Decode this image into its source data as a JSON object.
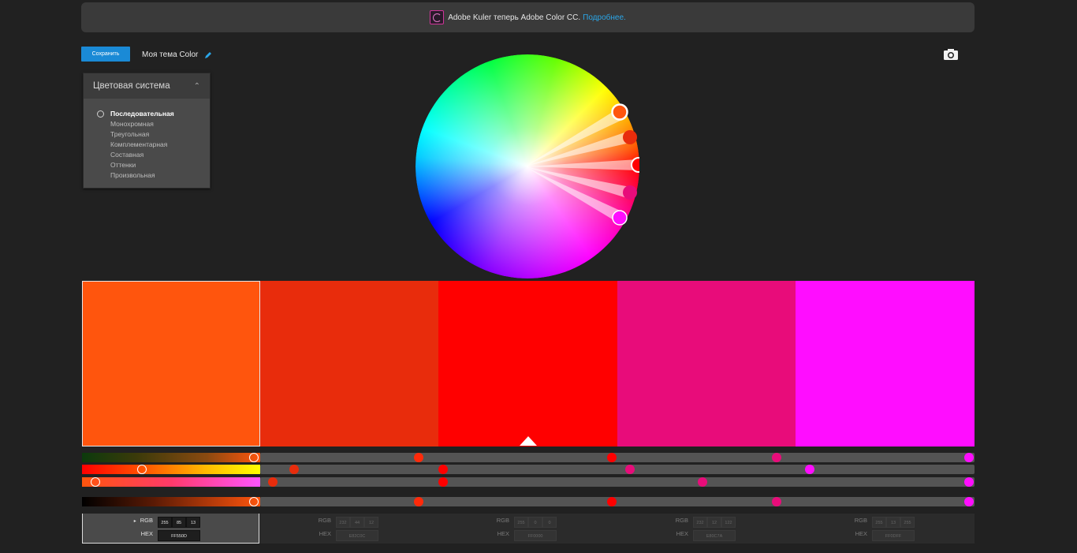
{
  "banner": {
    "text": "Adobe Kuler теперь Adobe Color CC.",
    "link": "Подробнее.",
    "icon": "adobe-color-logo-icon"
  },
  "toolbar": {
    "save_label": "Сохранить",
    "theme_name": "Моя тема Color",
    "edit_icon": "pencil-icon",
    "camera_icon": "camera-icon"
  },
  "rules": {
    "title": "Цветовая система",
    "collapse_icon": "chevron-up-icon",
    "items": [
      "Последовательная",
      "Монохромная",
      "Треугольная",
      "Комплементарная",
      "Составная",
      "Оттенки",
      "Произвольная"
    ],
    "selected": "Последовательная"
  },
  "swatches": [
    {
      "hex": "#FF550D",
      "rgb": [
        "255",
        "85",
        "13"
      ],
      "hex_label": "FF550D",
      "selected": true
    },
    {
      "hex": "#E82C0C",
      "rgb": [
        "232",
        "44",
        "12"
      ],
      "hex_label": "E82C0C",
      "selected": false
    },
    {
      "hex": "#FF0000",
      "rgb": [
        "255",
        "0",
        "0"
      ],
      "hex_label": "FF0000",
      "selected": false,
      "base": true
    },
    {
      "hex": "#E80C7A",
      "rgb": [
        "232",
        "12",
        "122"
      ],
      "hex_label": "E80C7A",
      "selected": false
    },
    {
      "hex": "#FF0DFF",
      "rgb": [
        "255",
        "13",
        "255"
      ],
      "hex_label": "FF0DFF",
      "selected": false
    }
  ],
  "labels": {
    "rgb": "RGB",
    "hex": "HEX",
    "expand_icon": "triangle-right-icon"
  },
  "colors": {
    "accent": "#1A8AD6",
    "link": "#2AA6E8",
    "background": "#212121"
  }
}
